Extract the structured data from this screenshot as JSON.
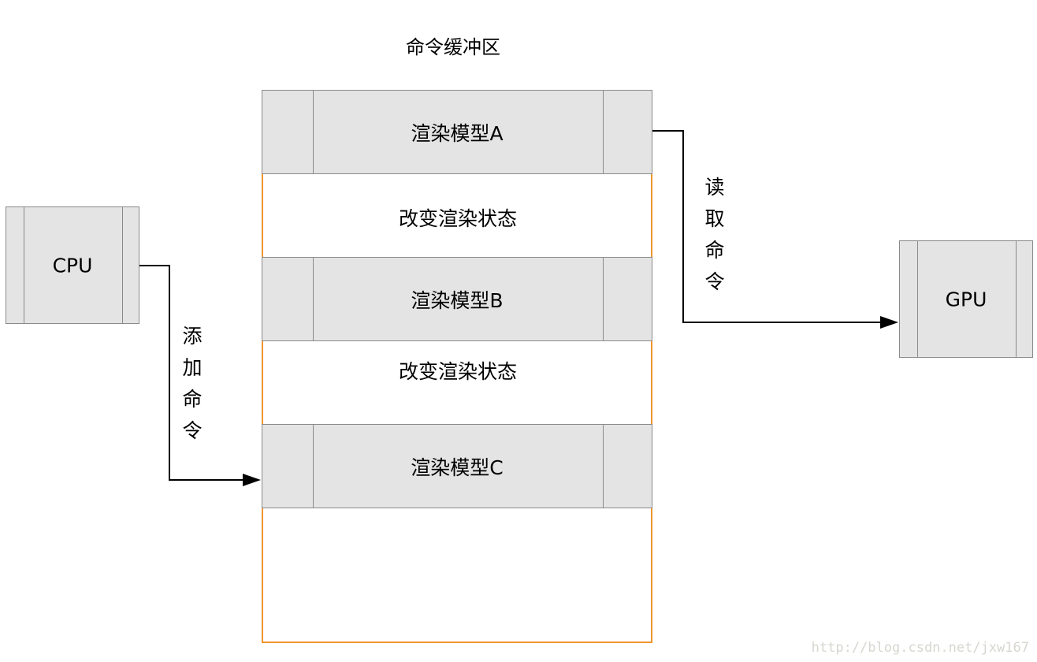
{
  "title": "命令缓冲区",
  "cpu": {
    "label": "CPU"
  },
  "gpu": {
    "label": "GPU"
  },
  "buffer_items": [
    {
      "type": "model",
      "label": "渲染模型A"
    },
    {
      "type": "state",
      "label": "改变渲染状态"
    },
    {
      "type": "model",
      "label": "渲染模型B"
    },
    {
      "type": "state",
      "label": "改变渲染状态"
    },
    {
      "type": "model",
      "label": "渲染模型C"
    }
  ],
  "edges": {
    "add_command": {
      "label_chars": [
        "添",
        "加",
        "命",
        "令"
      ],
      "from": "CPU",
      "to": "渲染模型C"
    },
    "read_command": {
      "label_chars": [
        "读",
        "取",
        "命",
        "令"
      ],
      "from": "渲染模型A",
      "to": "GPU"
    }
  },
  "colors": {
    "buffer_border": "#f0952f",
    "process_fill": "#e4e4e4",
    "process_border": "#8a8a8a"
  },
  "watermark": "http://blog.csdn.net/jxw167"
}
